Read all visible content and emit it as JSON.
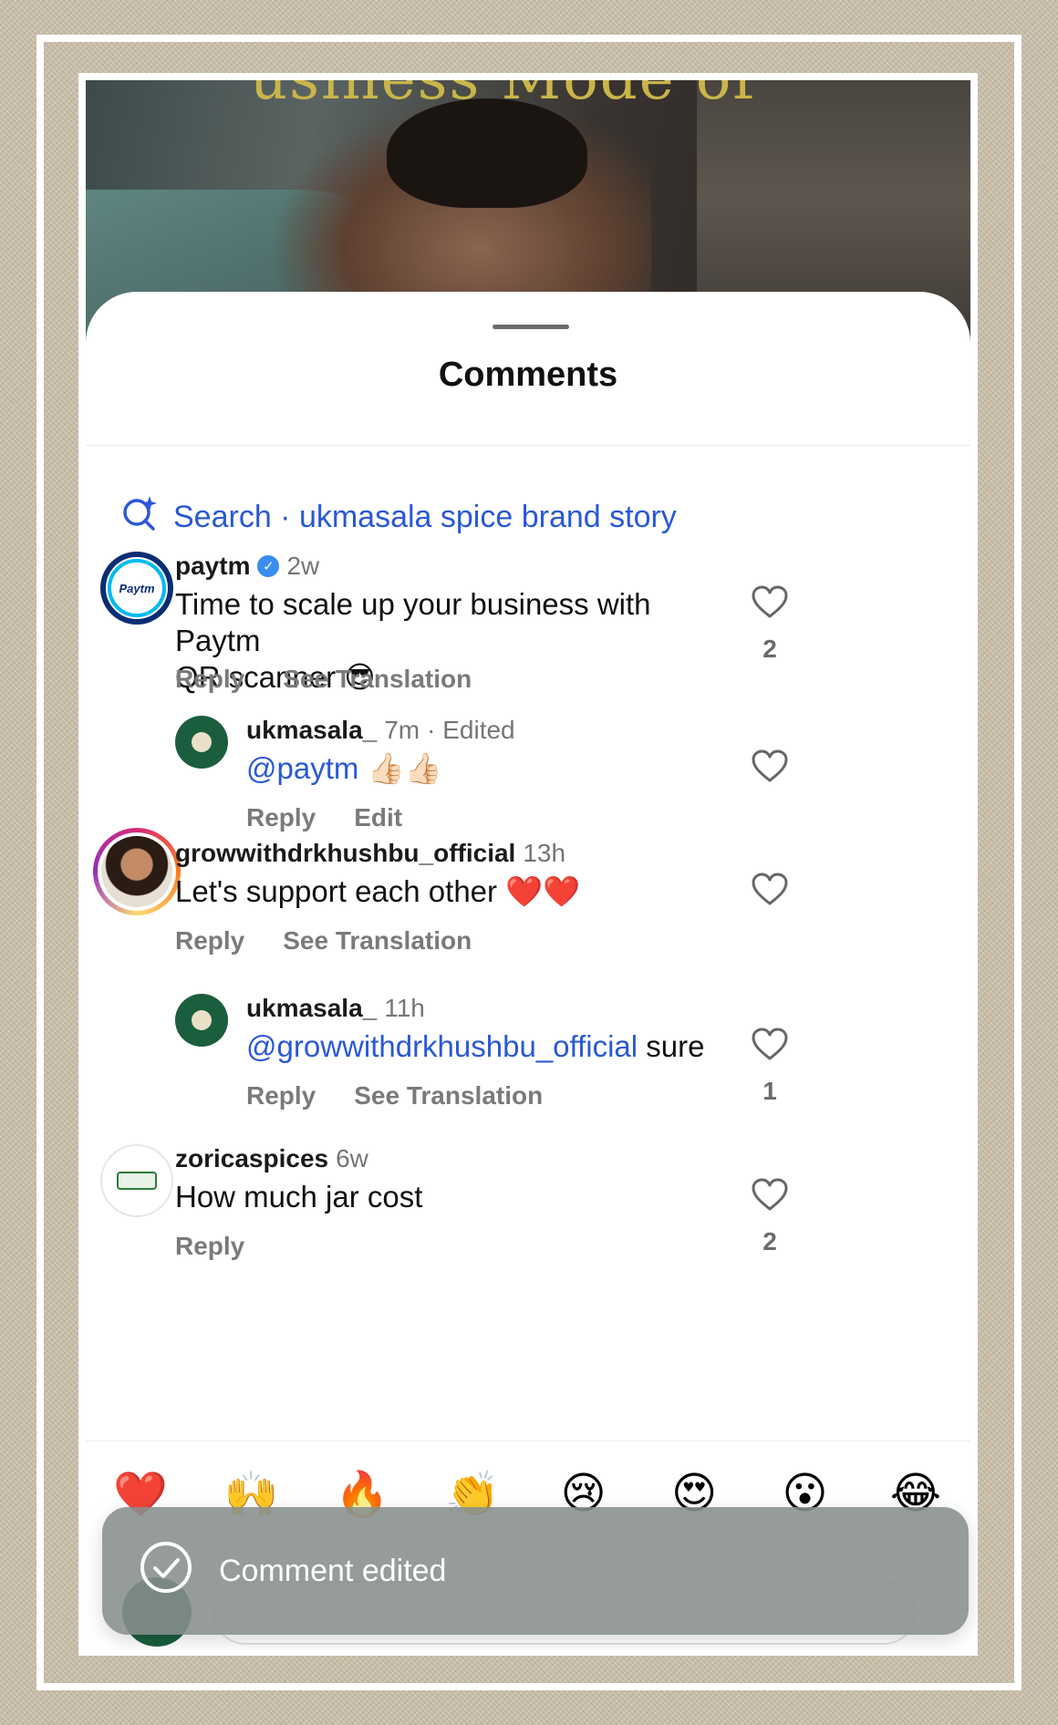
{
  "video": {
    "caption": "usiness Mode of"
  },
  "sheet": {
    "title": "Comments"
  },
  "search": {
    "label": "Search · ukmasala spice brand story"
  },
  "comments": [
    {
      "username": "paytm",
      "avatar_text": "Paytm",
      "verified": true,
      "time": "2w",
      "line1": "Time to scale up your business with Paytm",
      "line2": "QR scanner",
      "emoji": "😎",
      "actions": [
        "Reply",
        "See Translation"
      ],
      "likes": "2"
    },
    {
      "username": "ukmasala_",
      "time": "7m",
      "edited": "· Edited",
      "mention": "@paytm",
      "emoji": "👍🏻👍🏻",
      "actions": [
        "Reply",
        "Edit"
      ],
      "likes": ""
    },
    {
      "username": "growwithdrkhushbu_official",
      "time": "13h",
      "text": "Let's support each other",
      "emoji": "❤️❤️",
      "actions": [
        "Reply",
        "See Translation"
      ],
      "likes": ""
    },
    {
      "username": "ukmasala_",
      "time": "11h",
      "mention": "@growwithdrkhushbu_official",
      "text": " sure",
      "actions": [
        "Reply",
        "See Translation"
      ],
      "likes": "1"
    },
    {
      "username": "zoricaspices",
      "time": "6w",
      "text": "How much jar cost",
      "actions": [
        "Reply"
      ],
      "likes": "2"
    }
  ],
  "reactions": [
    "❤️",
    "🙌",
    "🔥",
    "👏",
    "😢",
    "😍",
    "😮",
    "😂"
  ],
  "toast": {
    "message": "Comment edited"
  },
  "colors": {
    "accent": "#2a58d6",
    "toast_bg": "#868e8c",
    "verified": "#3a8ef0"
  }
}
